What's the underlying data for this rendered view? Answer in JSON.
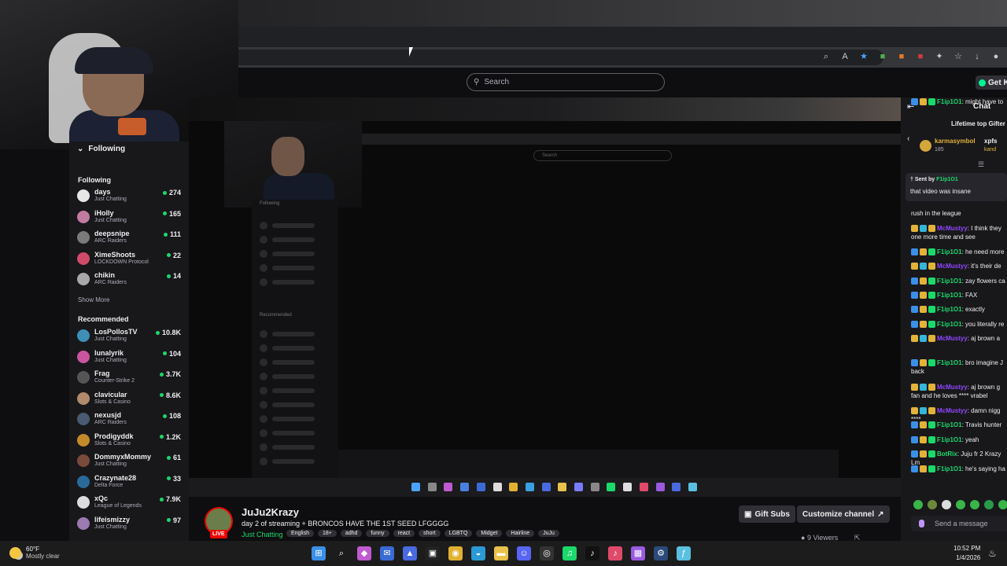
{
  "browser": {
    "toolbar_icons": [
      "zoom-icon",
      "read-aloud-icon",
      "star-icon",
      "extension-icon",
      "extension-icon",
      "extension-icon",
      "puzzle-icon",
      "favorites-icon",
      "download-icon",
      "profile-icon"
    ]
  },
  "twitch_nav": {
    "search_placeholder": "Search",
    "get_kicks_label": "Get Ki"
  },
  "sidebar": {
    "header": "Following",
    "following_label": "Following",
    "following": [
      {
        "name": "days",
        "game": "Just Chatting",
        "viewers": "274",
        "color": "#e6e6e6"
      },
      {
        "name": "iHolly",
        "game": "Just Chatting",
        "viewers": "165",
        "color": "#c27ba0"
      },
      {
        "name": "deepsnipe",
        "game": "ARC Raiders",
        "viewers": "111",
        "color": "#7a7a7a"
      },
      {
        "name": "XimeShoots",
        "game": "LOCKDOWN Protocol",
        "viewers": "22",
        "color": "#d04a6a"
      },
      {
        "name": "chikin",
        "game": "ARC Raiders",
        "viewers": "14",
        "color": "#a8a8a8"
      }
    ],
    "show_more": "Show More",
    "recommended_label": "Recommended",
    "recommended": [
      {
        "name": "LosPollosTV",
        "game": "Just Chatting",
        "viewers": "10.8K",
        "color": "#3d8fb5"
      },
      {
        "name": "lunalyrik",
        "game": "Just Chatting",
        "viewers": "104",
        "color": "#c955a0"
      },
      {
        "name": "Frag",
        "game": "Counter-Strike 2",
        "viewers": "3.7K",
        "color": "#555555"
      },
      {
        "name": "clavicular",
        "game": "Slots & Casino",
        "viewers": "8.6K",
        "color": "#b08a6a"
      },
      {
        "name": "nexusjd",
        "game": "ARC Raiders",
        "viewers": "108",
        "color": "#4a5a70"
      },
      {
        "name": "Prodigyddk",
        "game": "Slots & Casino",
        "viewers": "1.2K",
        "color": "#c48a2a"
      },
      {
        "name": "DommyxMommy",
        "game": "Just Chatting",
        "viewers": "61",
        "color": "#7a4a3a"
      },
      {
        "name": "Crazynate28",
        "game": "Delta Force",
        "viewers": "33",
        "color": "#2a6a9a"
      },
      {
        "name": "xQc",
        "game": "League of Legends",
        "viewers": "7.9K",
        "color": "#dcdcdc"
      },
      {
        "name": "lifeismizzy",
        "game": "Just Chatting",
        "viewers": "97",
        "color": "#9a7ab0"
      }
    ]
  },
  "stream": {
    "channel": "JuJu2Krazy",
    "live_badge": "LIVE",
    "title": "day 2 of streaming + BRONCOS HAVE THE 1ST SEED LFGGGG",
    "category": "Just Chatting",
    "tags": [
      "English",
      "18+",
      "adhd",
      "funny",
      "react",
      "short",
      "LGBTQ",
      "Midget",
      "Hairline",
      "JuJu"
    ],
    "gift_subs_label": "Gift Subs",
    "customize_label": "Customize channel",
    "viewers": "9 Viewers"
  },
  "video": {
    "search_placeholder": "Search",
    "following_label": "Following",
    "recommended_label": "Recommended"
  },
  "chat": {
    "title": "Chat",
    "gifters_title": "Lifetime top Gifter",
    "gifter1_name": "karmasymbol",
    "gifter1_count": "185",
    "gifter2_name": "xpfs",
    "gifter2_sub": "kand",
    "pinned_sent_by": "Sent by",
    "pinned_user": "F1ip1O1",
    "pinned_message": "that video was insane",
    "messages": [
      {
        "user": "",
        "text": "rush in the league",
        "color": "#efeff1",
        "lines": 1
      },
      {
        "user": "McMustyy",
        "text": "I think they",
        "extra": "one more time and see",
        "color": "#9146ff",
        "lines": 2
      },
      {
        "user": "F1ip1O1",
        "text": "he need more",
        "color": "#1bd96a",
        "lines": 1
      },
      {
        "user": "McMustyy",
        "text": "it's their de",
        "color": "#9146ff",
        "lines": 1
      },
      {
        "user": "F1ip1O1",
        "text": "zay flowers ca",
        "color": "#1bd96a",
        "lines": 1
      },
      {
        "user": "F1ip1O1",
        "text": "FAX",
        "color": "#1bd96a",
        "lines": 1
      },
      {
        "user": "F1ip1O1",
        "text": "exactly",
        "color": "#1bd96a",
        "lines": 1
      },
      {
        "user": "F1ip1O1",
        "text": "you literally re",
        "color": "#1bd96a",
        "lines": 1
      },
      {
        "user": "McMustyy",
        "text": "aj brown a",
        "color": "#9146ff",
        "lines": 1
      },
      {
        "user": "F1ip1O1",
        "text": "bro imagine J",
        "extra": "back",
        "color": "#1bd96a",
        "lines": 2
      },
      {
        "user": "McMustyy",
        "text": "aj brown g",
        "extra": "fan and he loves **** vrabel",
        "color": "#9146ff",
        "lines": 2
      },
      {
        "user": "McMustyy",
        "text": "damn nigg",
        "extra": "****",
        "color": "#9146ff",
        "lines": 2
      },
      {
        "user": "F1ip1O1",
        "text": "Travis hunter",
        "color": "#1bd96a",
        "lines": 1
      },
      {
        "user": "F1ip1O1",
        "text": "yeah",
        "color": "#1bd96a",
        "lines": 1
      },
      {
        "user": "BotRix",
        "text": "Juju fr 2 Krazy Lm",
        "color": "#1bd96a",
        "lines": 1
      },
      {
        "user": "F1ip1O1",
        "text": "he's saying ha",
        "color": "#1bd96a",
        "lines": 1
      },
      {
        "user": "F1ip1O1",
        "text": "might have to",
        "color": "#1bd96a",
        "lines": 1
      }
    ],
    "input_placeholder": "Send a message"
  },
  "taskbar": {
    "temperature": "60°F",
    "condition": "Mostly clear",
    "time": "10:52 PM",
    "date": "1/4/2026"
  },
  "colors": {
    "live_red": "#eb0400",
    "online_green": "#1bd96a",
    "purple": "#9146ff"
  }
}
